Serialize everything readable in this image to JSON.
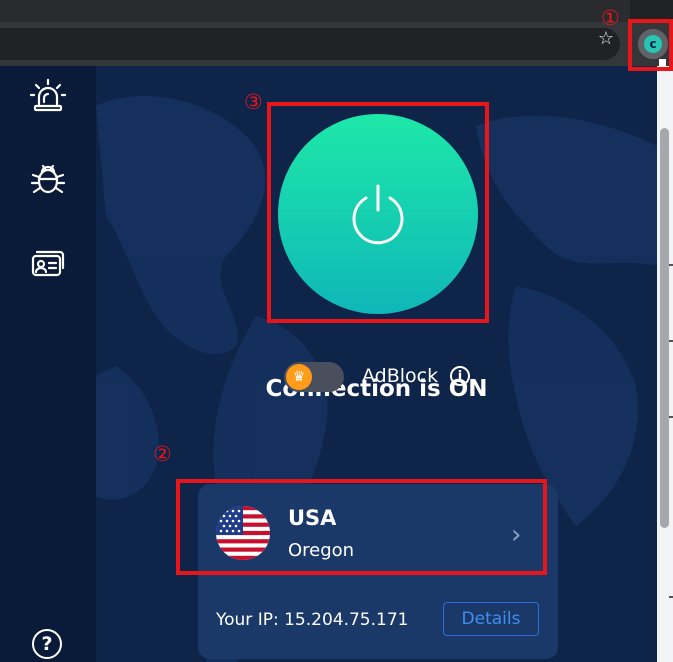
{
  "popup": {
    "status_text": "Connection is ON",
    "adblock_label": "AdBlock",
    "location": {
      "country": "USA",
      "region": "Oregon"
    },
    "ip_label": "Your IP: 15.204.75.171",
    "details_label": "Details"
  },
  "annotations": [
    "①",
    "②",
    "③"
  ],
  "colors": {
    "power_top": "#1ee8a8",
    "power_bottom": "#0fb7b8",
    "toggle_knob": "#ff9c1a",
    "details_border": "#2b6fd6",
    "annotation": "#e8161a"
  },
  "icons": [
    "siren-icon",
    "bug-icon",
    "id-card-icon",
    "help-icon",
    "power-icon",
    "crown-icon",
    "info-icon",
    "chevron-right-icon",
    "us-flag-icon",
    "star-icon",
    "extension-icon"
  ]
}
